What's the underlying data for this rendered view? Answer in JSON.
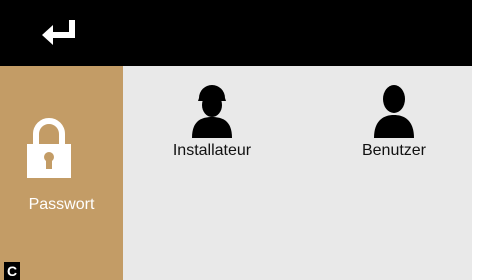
{
  "topbar": {
    "back_icon": "return-arrow-icon"
  },
  "sidebar": {
    "items": [
      {
        "label": "Passwort",
        "icon": "padlock-icon",
        "selected": true
      }
    ]
  },
  "main": {
    "tiles": [
      {
        "label": "Installateur",
        "icon": "installer-person-icon"
      },
      {
        "label": "Benutzer",
        "icon": "user-person-icon"
      }
    ]
  },
  "corner_badge": {
    "label": "C"
  },
  "colors": {
    "topbar": "#000000",
    "sidebar": "#c39c66",
    "content_bg": "#e9e9e9",
    "text_dark": "#111111",
    "text_light": "#ffffff"
  }
}
